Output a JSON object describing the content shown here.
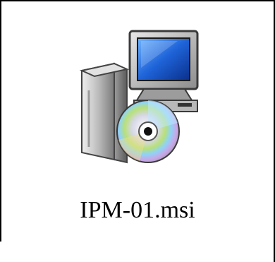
{
  "file": {
    "name": "IPM-01.msi",
    "icon": "msi-installer-icon",
    "type": "Windows Installer package"
  },
  "colors": {
    "background": "#ffffff",
    "border": "#000000",
    "monitor_frame": "#8c8c8c",
    "screen_blue": "#1e63d8",
    "box_gray": "#bdbdbd",
    "disc_silver": "#d7d7e6"
  }
}
